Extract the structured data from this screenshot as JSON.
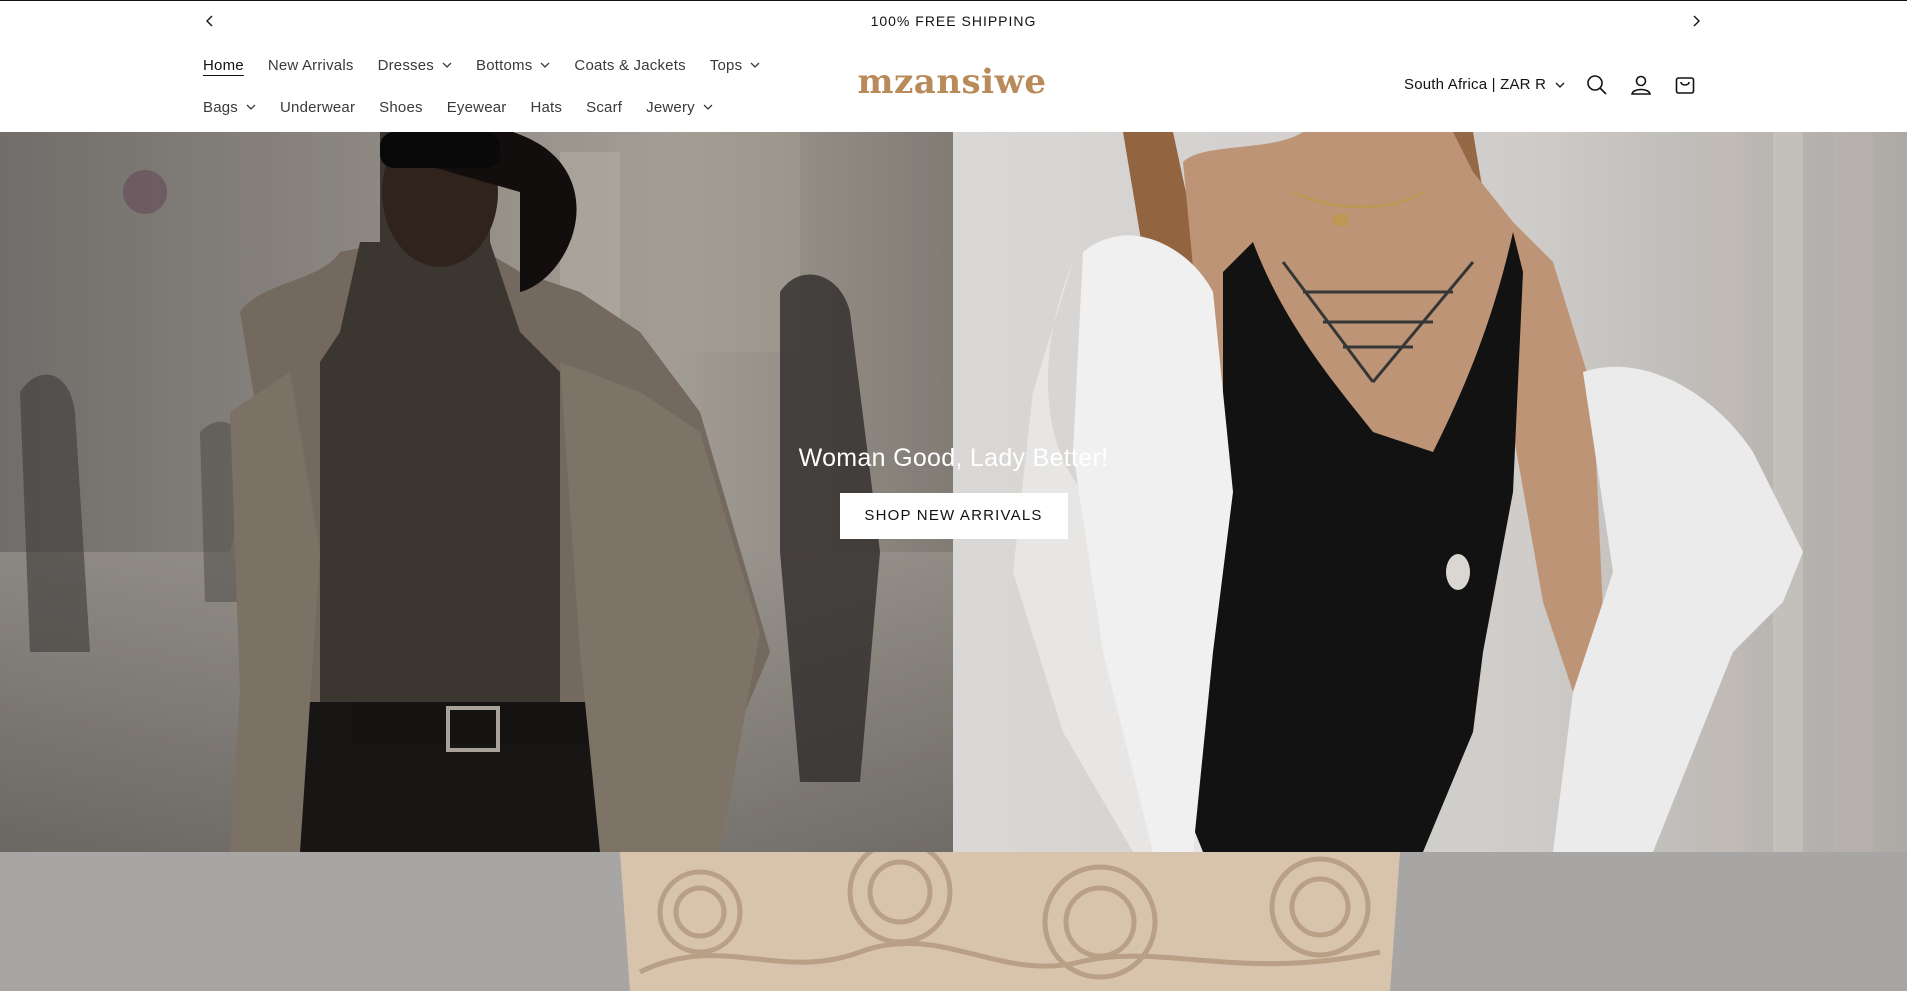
{
  "announcement": {
    "text": "100% FREE SHIPPING",
    "prev_icon": "chevron-left-icon",
    "next_icon": "chevron-right-icon"
  },
  "header": {
    "logo_text": "mzansiwe",
    "logo_color": "#b98a5a",
    "nav_row_1": [
      {
        "label": "Home",
        "active": true,
        "dropdown": false
      },
      {
        "label": "New Arrivals",
        "dropdown": false
      },
      {
        "label": "Dresses",
        "dropdown": true
      },
      {
        "label": "Bottoms",
        "dropdown": true
      },
      {
        "label": "Coats & Jackets",
        "dropdown": false
      },
      {
        "label": "Tops",
        "dropdown": true
      }
    ],
    "nav_row_2": [
      {
        "label": "Bags",
        "dropdown": true
      },
      {
        "label": "Underwear",
        "dropdown": false
      },
      {
        "label": "Shoes",
        "dropdown": false
      },
      {
        "label": "Eyewear",
        "dropdown": false
      },
      {
        "label": "Hats",
        "dropdown": false
      },
      {
        "label": "Scarf",
        "dropdown": false
      },
      {
        "label": "Jewery",
        "dropdown": true
      }
    ],
    "country_selector": "South Africa | ZAR R",
    "icons": [
      "search-icon",
      "account-icon",
      "cart-icon"
    ]
  },
  "hero": {
    "heading": "Woman Good, Lady Better!",
    "button_label": "SHOP NEW ARRIVALS"
  }
}
